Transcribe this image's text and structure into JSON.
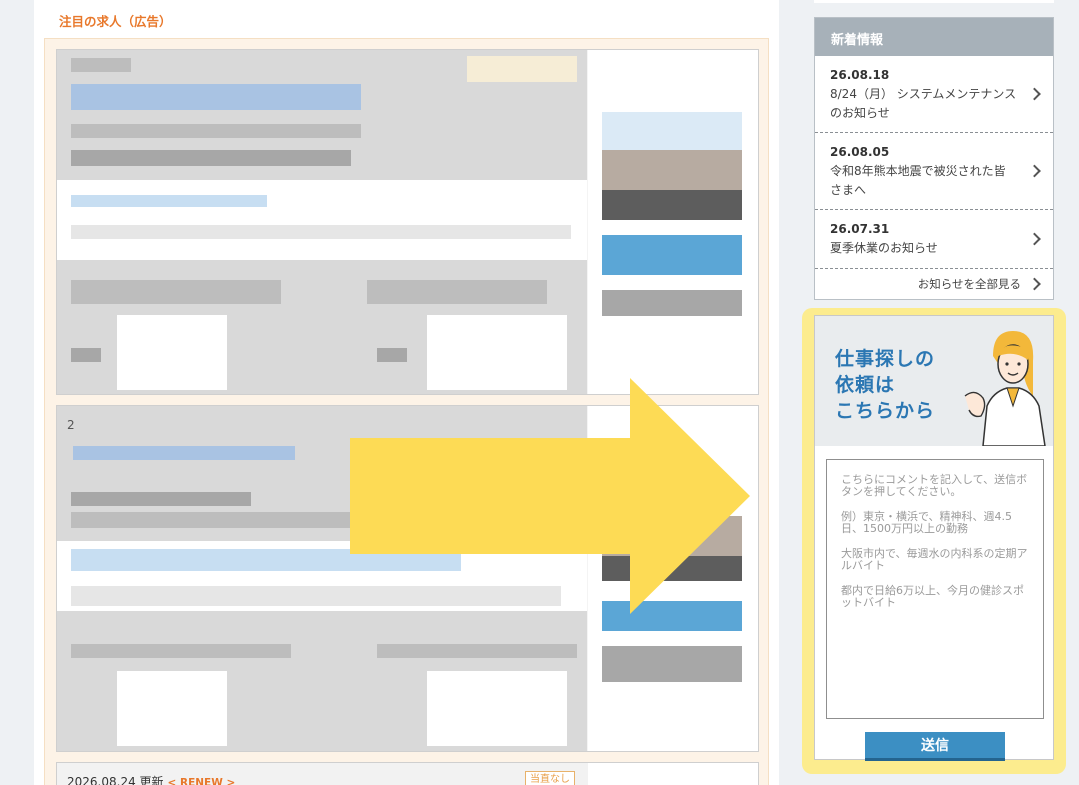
{
  "main": {
    "section_title": "注目の求人（広告）",
    "card2_number": "2",
    "card3": {
      "date": "2026.08.24 更新",
      "renew": "< RENEW >",
      "badge": "当直なし"
    }
  },
  "news": {
    "heading": "新着情報",
    "items": [
      {
        "date": "26.08.18",
        "text": "8/24（月） システムメンテナンスのお知らせ"
      },
      {
        "date": "26.08.05",
        "text": "令和8年熊本地震で被災された皆さまへ"
      },
      {
        "date": "26.07.31",
        "text": "夏季休業のお知らせ"
      }
    ],
    "see_all": "お知らせを全部見る"
  },
  "request": {
    "title_lines": [
      "仕事探しの",
      "依頼は",
      "こちらから"
    ],
    "placeholder_lines": [
      "こちらにコメントを記入して、送信ボタンを押してください。",
      "例）東京・横浜で、精神科、週4.5日、1500万円以上の勤務",
      "大阪市内で、毎週水の内科系の定期アルバイト",
      "都内で日給6万以上、今月の健診スポットバイト"
    ],
    "submit_label": "送信"
  },
  "colors": {
    "accent_orange": "#e8782b",
    "highlight_yellow": "#fcec8e",
    "arrow_yellow": "#fddb55",
    "button_blue": "#3c8fc3",
    "title_blue": "#2b77b3"
  }
}
